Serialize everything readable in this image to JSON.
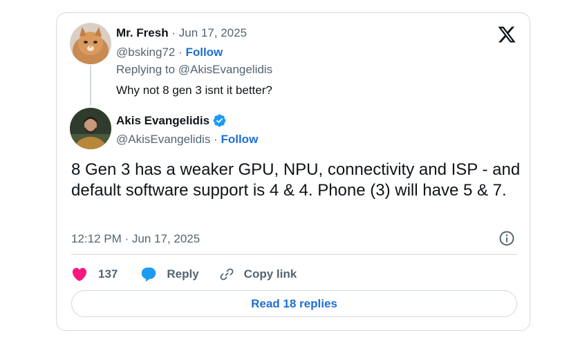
{
  "colors": {
    "follow_link": "#1d6fd6",
    "heart": "#f91880",
    "reply_bubble": "#1d9bf0",
    "verified_badge": "#1d9bf0",
    "muted_text": "#536471",
    "border": "#cfd9de"
  },
  "parent_tweet": {
    "author_name": "Mr. Fresh",
    "separator": "·",
    "date": "Jun 17, 2025",
    "handle": "@bsking72",
    "follow_label": "Follow",
    "replying_to": "Replying to @AkisEvangelidis",
    "text": "Why not 8 gen 3 isnt it better?"
  },
  "main_tweet": {
    "author_name": "Akis Evangelidis",
    "verified_icon": "verified-badge-icon",
    "handle": "@AkisEvangelidis",
    "separator": "·",
    "follow_label": "Follow",
    "text": "8 Gen 3 has a weaker GPU, NPU, connectivity and ISP - and default software support is 4 & 4. Phone (3) will have 5 & 7.",
    "timestamp": "12:12 PM · Jun 17, 2025"
  },
  "actions": {
    "like_count": "137",
    "reply_label": "Reply",
    "copy_link_label": "Copy link"
  },
  "read_replies_label": "Read 18 replies"
}
